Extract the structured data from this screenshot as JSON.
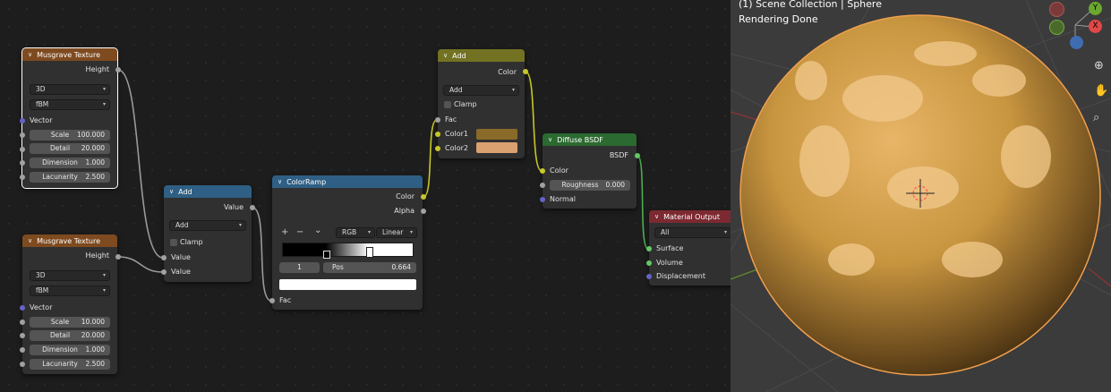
{
  "nodes": {
    "musgrave1": {
      "title": "Musgrave Texture",
      "output": "Height",
      "dimensions": "3D",
      "type": "fBM",
      "vector": "Vector",
      "fields": [
        {
          "label": "Scale",
          "value": "100.000"
        },
        {
          "label": "Detail",
          "value": "20.000"
        },
        {
          "label": "Dimension",
          "value": "1.000"
        },
        {
          "label": "Lacunarity",
          "value": "2.500"
        }
      ]
    },
    "musgrave2": {
      "title": "Musgrave Texture",
      "output": "Height",
      "dimensions": "3D",
      "type": "fBM",
      "vector": "Vector",
      "fields": [
        {
          "label": "Scale",
          "value": "10.000"
        },
        {
          "label": "Detail",
          "value": "20.000"
        },
        {
          "label": "Dimension",
          "value": "1.000"
        },
        {
          "label": "Lacunarity",
          "value": "2.500"
        }
      ]
    },
    "math_add": {
      "title": "Add",
      "output": "Value",
      "operation": "Add",
      "clamp": "Clamp",
      "inputs": [
        "Value",
        "Value"
      ]
    },
    "colorramp": {
      "title": "ColorRamp",
      "outputs": [
        "Color",
        "Alpha"
      ],
      "add_icon": "+",
      "remove_icon": "−",
      "menu_icon": "⌄",
      "color_mode": "RGB",
      "interpolation": "Linear",
      "stop_index": "1",
      "pos_label": "Pos",
      "pos_value": "0.664",
      "input": "Fac"
    },
    "mix_add": {
      "title": "Add",
      "output": "Color",
      "blend": "Add",
      "clamp": "Clamp",
      "fac": "Fac",
      "color1": "Color1",
      "color2": "Color2",
      "color1_hex": "#8a6a28",
      "color2_hex": "#d9a070"
    },
    "diffuse": {
      "title": "Diffuse BSDF",
      "output": "BSDF",
      "color": "Color",
      "roughness_label": "Roughness",
      "roughness_value": "0.000",
      "normal": "Normal"
    },
    "output": {
      "title": "Material Output",
      "target": "All",
      "inputs": [
        "Surface",
        "Volume",
        "Displacement"
      ]
    }
  },
  "viewport": {
    "line1": "(1) Scene Collection | Sphere",
    "line2": "Rendering Done",
    "gizmo": {
      "y": "Y",
      "x": "X"
    },
    "tools": [
      "zoom-icon",
      "hand-icon",
      "camera-icon"
    ]
  },
  "colors": {
    "texture_header": "#7e4a1f",
    "converter_header": "#2f5f84",
    "color_header": "#727222",
    "shader_header": "#2b6a30",
    "output_header": "#7c2931",
    "sphere_base": "#c8953f",
    "sphere_highlight": "#f2c98c"
  }
}
